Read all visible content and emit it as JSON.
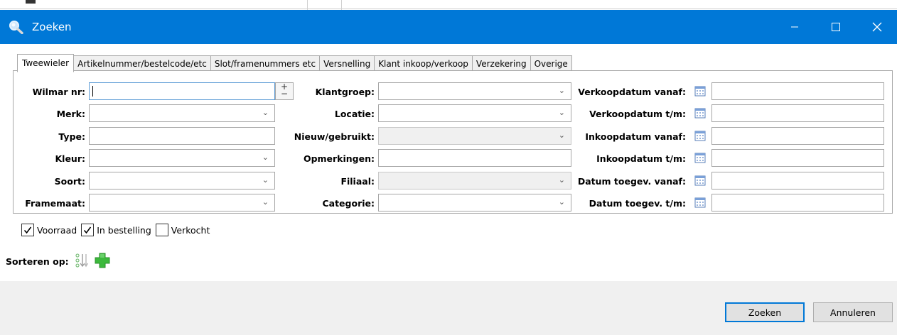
{
  "window": {
    "title": "Zoeken"
  },
  "tabs": [
    "Tweewieler",
    "Artikelnummer/bestelcode/etc",
    "Slot/framenummers etc",
    "Versnelling",
    "Klant inkoop/verkoop",
    "Verzekering",
    "Overige"
  ],
  "col1": {
    "wilmar_nr": "Wilmar nr:",
    "merk": "Merk:",
    "type": "Type:",
    "kleur": "Kleur:",
    "soort": "Soort:",
    "framemaat": "Framemaat:",
    "spin_plus": "+",
    "spin_minus": "−"
  },
  "col2": {
    "klantgroep": "Klantgroep:",
    "locatie": "Locatie:",
    "nieuw_gebruikt": "Nieuw/gebruikt:",
    "opmerkingen": "Opmerkingen:",
    "filiaal": "Filiaal:",
    "categorie": "Categorie:"
  },
  "col3": {
    "verkoop_vanaf": "Verkoopdatum vanaf:",
    "verkoop_tm": "Verkoopdatum t/m:",
    "inkoop_vanaf": "Inkoopdatum vanaf:",
    "inkoop_tm": "Inkoopdatum t/m:",
    "toegev_vanaf": "Datum toegev. vanaf:",
    "toegev_tm": "Datum toegev. t/m:"
  },
  "chevron": "⌄",
  "checkboxes": [
    {
      "label": "Voorraad",
      "checked": true
    },
    {
      "label": "In bestelling",
      "checked": true
    },
    {
      "label": "Verkocht",
      "checked": false
    }
  ],
  "sort": {
    "label": "Sorteren op:",
    "icons": [
      "sort-order-icon",
      "add-icon"
    ]
  },
  "buttons": {
    "search": "Zoeken",
    "cancel": "Annuleren"
  },
  "colors": {
    "titlebar": "#0078d7",
    "footer": "#f0f0f0",
    "add_green": "#3cb93c"
  }
}
